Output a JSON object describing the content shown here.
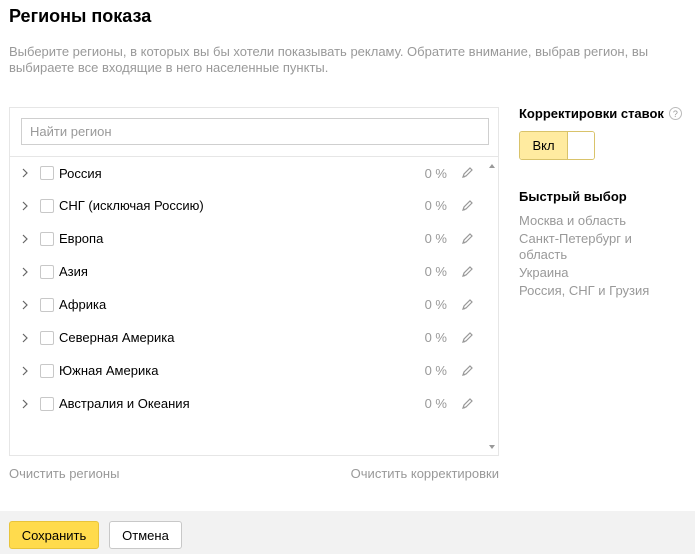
{
  "title": "Регионы показа",
  "description": "Выберите регионы, в которых вы бы хотели показывать рекламу. Обратите внимание, выбрав регион, вы выбираете все входящие в него населенные пункты.",
  "search": {
    "placeholder": "Найти регион",
    "value": ""
  },
  "regions": [
    {
      "name": "Россия",
      "percent": "0 %"
    },
    {
      "name": "СНГ (исключая Россию)",
      "percent": "0 %"
    },
    {
      "name": "Европа",
      "percent": "0 %"
    },
    {
      "name": "Азия",
      "percent": "0 %"
    },
    {
      "name": "Африка",
      "percent": "0 %"
    },
    {
      "name": "Северная Америка",
      "percent": "0 %"
    },
    {
      "name": "Южная Америка",
      "percent": "0 %"
    },
    {
      "name": "Австралия и Океания",
      "percent": "0 %"
    }
  ],
  "links": {
    "clear_regions": "Очистить регионы",
    "clear_adjustments": "Очистить корректировки"
  },
  "adjustments": {
    "title": "Корректировки ставок",
    "help_icon": "?",
    "toggle_label": "Вкл",
    "toggle_state": "on"
  },
  "quick_select": {
    "title": "Быстрый выбор",
    "items": [
      "Москва и область",
      "Санкт-Петербург и область",
      "Украина",
      "Россия, СНГ и Грузия"
    ]
  },
  "footer": {
    "save_label": "Сохранить",
    "cancel_label": "Отмена"
  },
  "colors": {
    "accent": "#ffdb4d",
    "toggle_on": "#ffeba0",
    "muted_text": "#999999",
    "footer_bg": "#f2f2f2"
  }
}
